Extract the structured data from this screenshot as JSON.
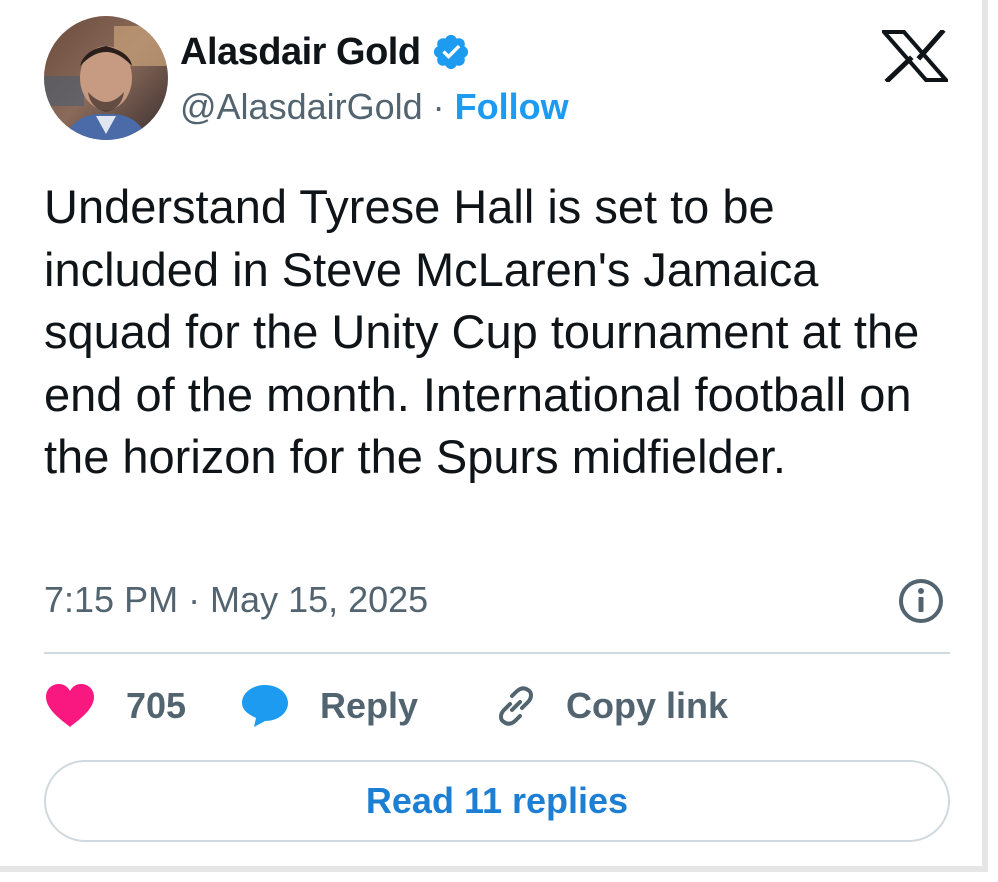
{
  "author": {
    "display_name": "Alasdair Gold",
    "handle": "@AlasdairGold",
    "separator": "·",
    "follow_label": "Follow",
    "verified": true
  },
  "tweet": {
    "text": "Understand Tyrese Hall is set to be included in Steve McLaren's Jamaica squad for the Unity Cup tournament at the end of the month. International football on the horizon for the Spurs midfielder.",
    "timestamp": "7:15 PM · May 15, 2025"
  },
  "actions": {
    "like_count": "705",
    "reply_label": "Reply",
    "copy_link_label": "Copy link"
  },
  "read_replies_label": "Read 11 replies",
  "icons": {
    "brand": "x-logo-icon",
    "verified": "verified-badge-icon",
    "info": "info-icon",
    "like": "heart-icon",
    "reply": "speech-bubble-icon",
    "copy": "link-icon"
  },
  "colors": {
    "accent": "#1d9bf0",
    "heart": "#f91880",
    "text": "#0f1419",
    "muted": "#536471",
    "border": "#cfd9de"
  }
}
